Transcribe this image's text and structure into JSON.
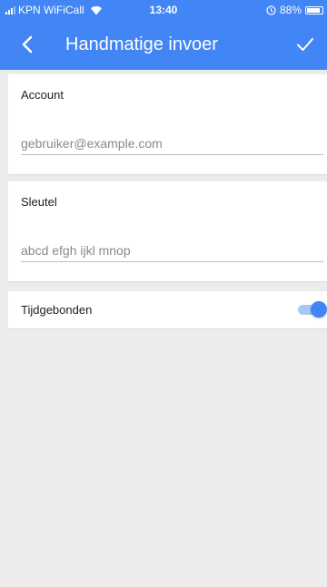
{
  "status_bar": {
    "carrier": "KPN WiFiCall",
    "time": "13:40",
    "battery_text": "88%",
    "battery_level": 0.88,
    "signal_bars_filled": 3,
    "signal_bars_total": 4
  },
  "toolbar": {
    "title": "Handmatige invoer",
    "back_icon": "chevron-left-icon",
    "confirm_icon": "checkmark-icon"
  },
  "account": {
    "label": "Account",
    "placeholder": "gebruiker@example.com",
    "value": ""
  },
  "key": {
    "label": "Sleutel",
    "placeholder": "abcd efgh ijkl mnop",
    "value": ""
  },
  "time_based": {
    "label": "Tijdgebonden",
    "enabled": true
  },
  "colors": {
    "accent": "#4285f4",
    "background": "#ececec",
    "card": "#ffffff"
  }
}
